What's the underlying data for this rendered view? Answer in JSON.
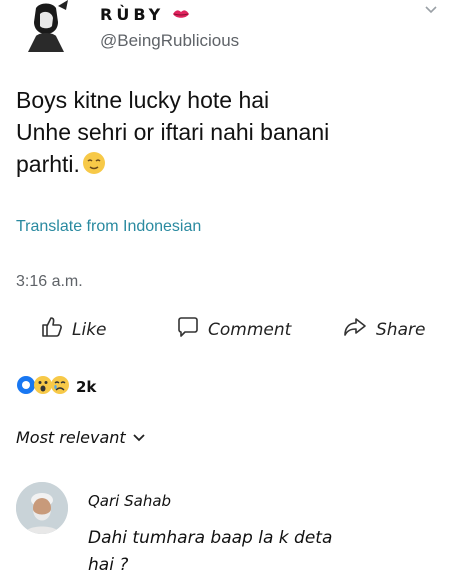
{
  "post": {
    "author_name": "RÙBY",
    "author_handle": "@BeingRublicious",
    "text_lines": [
      "Boys kitne lucky hote hai",
      "Unhe sehri or iftari nahi banani",
      "parhti."
    ],
    "translate_label": "Translate from Indonesian",
    "time": "3:16 a.m."
  },
  "actions": {
    "like_label": "Like",
    "comment_label": "Comment",
    "share_label": "Share"
  },
  "reactions": {
    "count": "2k"
  },
  "comments_filter": {
    "label": "Most relevant"
  },
  "comment": {
    "author": "Qari Sahab",
    "text_lines": [
      "Dahi tumhara baap la k deta",
      "hai ?"
    ]
  },
  "colors": {
    "link": "#2a8aa0",
    "reaction_blue": "#1877f2",
    "reaction_yellow": "#f7c948"
  }
}
